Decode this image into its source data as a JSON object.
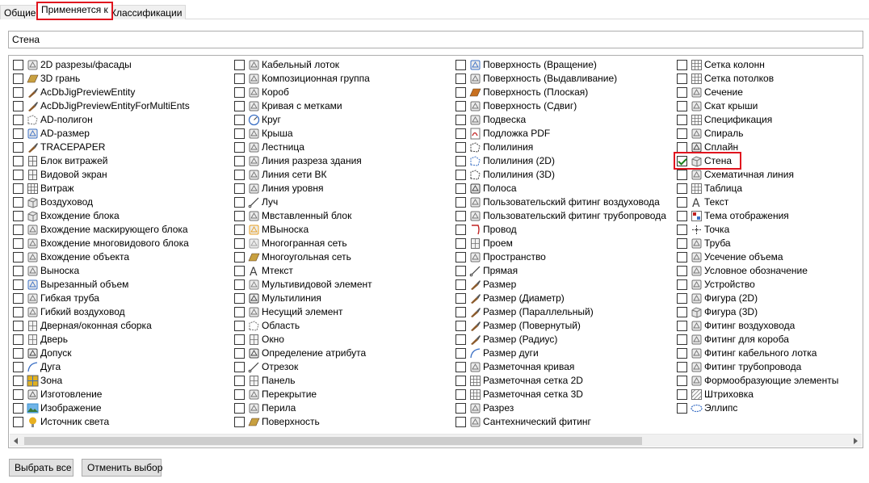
{
  "tabs": [
    {
      "label": "Общие",
      "active": false
    },
    {
      "label": "Применяется к",
      "active": true
    },
    {
      "label": "Классификации",
      "active": false
    }
  ],
  "search": {
    "value": "Стена"
  },
  "columns": [
    {
      "items": [
        {
          "label": "2D разрезы/фасады",
          "checked": false,
          "icon": "building-section-icon",
          "color": "#707070"
        },
        {
          "label": "3D грань",
          "checked": false,
          "icon": "face-3d-icon",
          "color": "#c8a040"
        },
        {
          "label": "AcDbJigPreviewEntity",
          "checked": false,
          "icon": "brush-icon",
          "color": "#8b5a2b"
        },
        {
          "label": "AcDbJigPreviewEntityForMultiEnts",
          "checked": false,
          "icon": "brush-icon",
          "color": "#8b5a2b"
        },
        {
          "label": "AD-полигон",
          "checked": false,
          "icon": "dashed-rect-icon",
          "color": "#707070"
        },
        {
          "label": "AD-размер",
          "checked": false,
          "icon": "dimension-icon",
          "color": "#3a6fc4"
        },
        {
          "label": "TRACEPAPER",
          "checked": false,
          "icon": "brush-icon",
          "color": "#8b5a2b"
        },
        {
          "label": "Блок витражей",
          "checked": false,
          "icon": "curtain-wall-block-icon",
          "color": "#606060"
        },
        {
          "label": "Видовой экран",
          "checked": false,
          "icon": "viewport-icon",
          "color": "#606060"
        },
        {
          "label": "Витраж",
          "checked": false,
          "icon": "curtain-wall-icon",
          "color": "#606060"
        },
        {
          "label": "Воздуховод",
          "checked": false,
          "icon": "duct-icon",
          "color": "#707070"
        },
        {
          "label": "Вхождение блока",
          "checked": false,
          "icon": "block-ref-icon",
          "color": "#707070"
        },
        {
          "label": "Вхождение маскирующего блока",
          "checked": false,
          "icon": "mask-block-icon",
          "color": "#707070"
        },
        {
          "label": "Вхождение многовидового блока",
          "checked": false,
          "icon": "multiview-block-icon",
          "color": "#707070"
        },
        {
          "label": "Вхождение объекта",
          "checked": false,
          "icon": "object-ref-icon",
          "color": "#707070"
        },
        {
          "label": "Выноска",
          "checked": false,
          "icon": "callout-icon",
          "color": "#707070"
        },
        {
          "label": "Вырезанный объем",
          "checked": false,
          "icon": "cut-volume-icon",
          "color": "#3a6fc4"
        },
        {
          "label": "Гибкая труба",
          "checked": false,
          "icon": "flex-pipe-icon",
          "color": "#707070"
        },
        {
          "label": "Гибкий воздуховод",
          "checked": false,
          "icon": "flex-duct-icon",
          "color": "#707070"
        },
        {
          "label": "Дверная/оконная сборка",
          "checked": false,
          "icon": "door-window-icon",
          "color": "#707070"
        },
        {
          "label": "Дверь",
          "checked": false,
          "icon": "door-icon",
          "color": "#707070"
        },
        {
          "label": "Допуск",
          "checked": false,
          "icon": "tolerance-icon",
          "color": "#404040"
        },
        {
          "label": "Дуга",
          "checked": false,
          "icon": "arc-icon",
          "color": "#3a6fc4"
        },
        {
          "label": "Зона",
          "checked": false,
          "icon": "zone-icon",
          "color": "#e0b020"
        },
        {
          "label": "Изготовление",
          "checked": false,
          "icon": "fabrication-icon",
          "color": "#606060"
        },
        {
          "label": "Изображение",
          "checked": false,
          "icon": "image-icon",
          "color": "#3a8fd0"
        },
        {
          "label": "Источник света",
          "checked": false,
          "icon": "light-icon",
          "color": "#e8b020"
        }
      ]
    },
    {
      "items": [
        {
          "label": "Кабельный лоток",
          "checked": false,
          "icon": "cable-tray-icon",
          "color": "#707070"
        },
        {
          "label": "Композиционная группа",
          "checked": false,
          "icon": "composition-group-icon",
          "color": "#707070"
        },
        {
          "label": "Короб",
          "checked": false,
          "icon": "conduit-icon",
          "color": "#707070"
        },
        {
          "label": "Кривая с метками",
          "checked": false,
          "icon": "tagged-curve-icon",
          "color": "#707070"
        },
        {
          "label": "Круг",
          "checked": false,
          "icon": "circle-icon",
          "color": "#3a6fc4"
        },
        {
          "label": "Крыша",
          "checked": false,
          "icon": "roof-icon",
          "color": "#707070"
        },
        {
          "label": "Лестница",
          "checked": false,
          "icon": "stair-icon",
          "color": "#707070"
        },
        {
          "label": "Линия разреза здания",
          "checked": false,
          "icon": "section-line-icon",
          "color": "#707070"
        },
        {
          "label": "Линия сети ВК",
          "checked": false,
          "icon": "grid-line-icon",
          "color": "#707070"
        },
        {
          "label": "Линия уровня",
          "checked": false,
          "icon": "level-line-icon",
          "color": "#707070"
        },
        {
          "label": "Луч",
          "checked": false,
          "icon": "ray-icon",
          "color": "#404040"
        },
        {
          "label": "Мвставленный блок",
          "checked": false,
          "icon": "minsert-icon",
          "color": "#707070"
        },
        {
          "label": "МВыноска",
          "checked": false,
          "icon": "mleader-icon",
          "color": "#e8a020"
        },
        {
          "label": "Многогранная сеть",
          "checked": false,
          "icon": "polyface-mesh-icon",
          "color": "#a0a0a0"
        },
        {
          "label": "Многоугольная сеть",
          "checked": false,
          "icon": "polygon-mesh-icon",
          "color": "#c8a040"
        },
        {
          "label": "Мтекст",
          "checked": false,
          "icon": "mtext-icon",
          "color": "#404040"
        },
        {
          "label": "Мультивидовой элемент",
          "checked": false,
          "icon": "multiview-element-icon",
          "color": "#808080"
        },
        {
          "label": "Мультилиния",
          "checked": false,
          "icon": "mline-icon",
          "color": "#404040"
        },
        {
          "label": "Несущий элемент",
          "checked": false,
          "icon": "structural-member-icon",
          "color": "#707070"
        },
        {
          "label": "Область",
          "checked": false,
          "icon": "region-icon",
          "color": "#707070"
        },
        {
          "label": "Окно",
          "checked": false,
          "icon": "window-icon",
          "color": "#707070"
        },
        {
          "label": "Определение атрибута",
          "checked": false,
          "icon": "attribute-def-icon",
          "color": "#404040"
        },
        {
          "label": "Отрезок",
          "checked": false,
          "icon": "line-icon",
          "color": "#404040"
        },
        {
          "label": "Панель",
          "checked": false,
          "icon": "panel-icon",
          "color": "#707070"
        },
        {
          "label": "Перекрытие",
          "checked": false,
          "icon": "slab-icon",
          "color": "#707070"
        },
        {
          "label": "Перила",
          "checked": false,
          "icon": "railing-icon",
          "color": "#707070"
        },
        {
          "label": "Поверхность",
          "checked": false,
          "icon": "surface-icon",
          "color": "#c8a040"
        }
      ]
    },
    {
      "items": [
        {
          "label": "Поверхность (Вращение)",
          "checked": false,
          "icon": "surface-revolve-icon",
          "color": "#3a6fc4"
        },
        {
          "label": "Поверхность (Выдавливание)",
          "checked": false,
          "icon": "surface-extrude-icon",
          "color": "#707070"
        },
        {
          "label": "Поверхность (Плоская)",
          "checked": false,
          "icon": "surface-planar-icon",
          "color": "#c87020"
        },
        {
          "label": "Поверхность (Сдвиг)",
          "checked": false,
          "icon": "surface-sweep-icon",
          "color": "#707070"
        },
        {
          "label": "Подвеска",
          "checked": false,
          "icon": "hanger-icon",
          "color": "#707070"
        },
        {
          "label": "Подложка PDF",
          "checked": false,
          "icon": "pdf-underlay-icon",
          "color": "#c02020"
        },
        {
          "label": "Полилиния",
          "checked": false,
          "icon": "polyline-icon",
          "color": "#404040"
        },
        {
          "label": "Полилиния (2D)",
          "checked": false,
          "icon": "polyline-2d-icon",
          "color": "#3a6fc4"
        },
        {
          "label": "Полилиния (3D)",
          "checked": false,
          "icon": "polyline-3d-icon",
          "color": "#404040"
        },
        {
          "label": "Полоса",
          "checked": false,
          "icon": "trace-icon",
          "color": "#404040"
        },
        {
          "label": "Пользовательский фитинг воздуховода",
          "checked": false,
          "icon": "duct-fitting-icon",
          "color": "#707070"
        },
        {
          "label": "Пользовательский фитинг трубопровода",
          "checked": false,
          "icon": "pipe-fitting-icon",
          "color": "#707070"
        },
        {
          "label": "Провод",
          "checked": false,
          "icon": "wire-icon",
          "color": "#c02020"
        },
        {
          "label": "Проем",
          "checked": false,
          "icon": "opening-icon",
          "color": "#707070"
        },
        {
          "label": "Пространство",
          "checked": false,
          "icon": "space-icon",
          "color": "#707070"
        },
        {
          "label": "Прямая",
          "checked": false,
          "icon": "xline-icon",
          "color": "#404040"
        },
        {
          "label": "Размер",
          "checked": false,
          "icon": "dimension-brush-icon",
          "color": "#8b5a2b"
        },
        {
          "label": "Размер (Диаметр)",
          "checked": false,
          "icon": "dimension-brush-icon",
          "color": "#8b5a2b"
        },
        {
          "label": "Размер (Параллельный)",
          "checked": false,
          "icon": "dimension-brush-icon",
          "color": "#8b5a2b"
        },
        {
          "label": "Размер (Повернутый)",
          "checked": false,
          "icon": "dimension-brush-icon",
          "color": "#8b5a2b"
        },
        {
          "label": "Размер (Радиус)",
          "checked": false,
          "icon": "dimension-brush-icon",
          "color": "#8b5a2b"
        },
        {
          "label": "Размер дуги",
          "checked": false,
          "icon": "arc-dimension-icon",
          "color": "#3a6fc4"
        },
        {
          "label": "Разметочная кривая",
          "checked": false,
          "icon": "layout-curve-icon",
          "color": "#707070"
        },
        {
          "label": "Разметочная сетка 2D",
          "checked": false,
          "icon": "layout-grid-2d-icon",
          "color": "#707070"
        },
        {
          "label": "Разметочная сетка 3D",
          "checked": false,
          "icon": "layout-grid-3d-icon",
          "color": "#707070"
        },
        {
          "label": "Разрез",
          "checked": false,
          "icon": "section-icon",
          "color": "#707070"
        },
        {
          "label": "Сантехнический фитинг",
          "checked": false,
          "icon": "plumbing-fitting-icon",
          "color": "#707070"
        }
      ]
    },
    {
      "items": [
        {
          "label": "Сетка колонн",
          "checked": false,
          "icon": "column-grid-icon",
          "color": "#707070"
        },
        {
          "label": "Сетка потолков",
          "checked": false,
          "icon": "ceiling-grid-icon",
          "color": "#707070"
        },
        {
          "label": "Сечение",
          "checked": false,
          "icon": "section-mark-icon",
          "color": "#707070"
        },
        {
          "label": "Скат крыши",
          "checked": false,
          "icon": "roof-slab-icon",
          "color": "#707070"
        },
        {
          "label": "Спецификация",
          "checked": false,
          "icon": "schedule-icon",
          "color": "#707070"
        },
        {
          "label": "Спираль",
          "checked": false,
          "icon": "helix-icon",
          "color": "#707070"
        },
        {
          "label": "Сплайн",
          "checked": false,
          "icon": "spline-icon",
          "color": "#404040"
        },
        {
          "label": "Стена",
          "checked": true,
          "icon": "wall-icon",
          "color": "#707070"
        },
        {
          "label": "Схематичная линия",
          "checked": false,
          "icon": "schematic-line-icon",
          "color": "#707070"
        },
        {
          "label": "Таблица",
          "checked": false,
          "icon": "table-icon",
          "color": "#707070"
        },
        {
          "label": "Текст",
          "checked": false,
          "icon": "text-icon",
          "color": "#404040"
        },
        {
          "label": "Тема отображения",
          "checked": false,
          "icon": "display-theme-icon",
          "color": "#c02020"
        },
        {
          "label": "Точка",
          "checked": false,
          "icon": "point-icon",
          "color": "#404040"
        },
        {
          "label": "Труба",
          "checked": false,
          "icon": "pipe-icon",
          "color": "#707070"
        },
        {
          "label": "Усечение объема",
          "checked": false,
          "icon": "clip-volume-icon",
          "color": "#707070"
        },
        {
          "label": "Условное обозначение",
          "checked": false,
          "icon": "symbol-icon",
          "color": "#707070"
        },
        {
          "label": "Устройство",
          "checked": false,
          "icon": "device-icon",
          "color": "#707070"
        },
        {
          "label": "Фигура (2D)",
          "checked": false,
          "icon": "shape-2d-icon",
          "color": "#707070"
        },
        {
          "label": "Фигура (3D)",
          "checked": false,
          "icon": "shape-3d-icon",
          "color": "#707070"
        },
        {
          "label": "Фитинг воздуховода",
          "checked": false,
          "icon": "duct-fitting-std-icon",
          "color": "#707070"
        },
        {
          "label": "Фитинг для короба",
          "checked": false,
          "icon": "conduit-fitting-icon",
          "color": "#707070"
        },
        {
          "label": "Фитинг кабельного лотка",
          "checked": false,
          "icon": "cable-tray-fitting-icon",
          "color": "#707070"
        },
        {
          "label": "Фитинг трубопровода",
          "checked": false,
          "icon": "pipe-fitting-std-icon",
          "color": "#707070"
        },
        {
          "label": "Формообразующие элементы",
          "checked": false,
          "icon": "mass-element-icon",
          "color": "#707070"
        },
        {
          "label": "Штриховка",
          "checked": false,
          "icon": "hatch-icon",
          "color": "#707070"
        },
        {
          "label": "Эллипс",
          "checked": false,
          "icon": "ellipse-icon",
          "color": "#3a6fc4"
        }
      ]
    }
  ],
  "buttons": {
    "select_all": "Выбрать все",
    "clear_selection": "Отменить выбор"
  },
  "accent_color": "#e0141e"
}
